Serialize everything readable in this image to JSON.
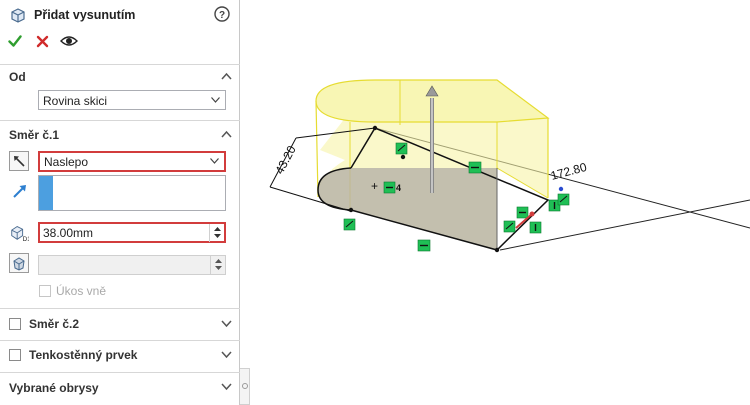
{
  "feature": {
    "title": "Přidat vysunutím"
  },
  "groups": {
    "from": {
      "title": "Od",
      "start_condition": "Rovina skici"
    },
    "direction1": {
      "title": "Směr č.1",
      "end_condition": "Naslepo",
      "depth": "38.00mm",
      "draft_outward_label": "Úkos vně"
    },
    "direction2": {
      "title": "Směr č.2"
    },
    "thin_feature": {
      "title": "Tenkostěnný prvek"
    },
    "selected_contours": {
      "title": "Vybrané obrysy"
    }
  },
  "viewport": {
    "dimension_width": "43.20",
    "dimension_length": "172.80",
    "relation_mark": "4"
  },
  "colors": {
    "accent_blue": "#4c9fe0",
    "highlight_red": "#d23c3c",
    "preview_yellow": "#f6f4a6",
    "relation_green": "#1fbf55"
  }
}
